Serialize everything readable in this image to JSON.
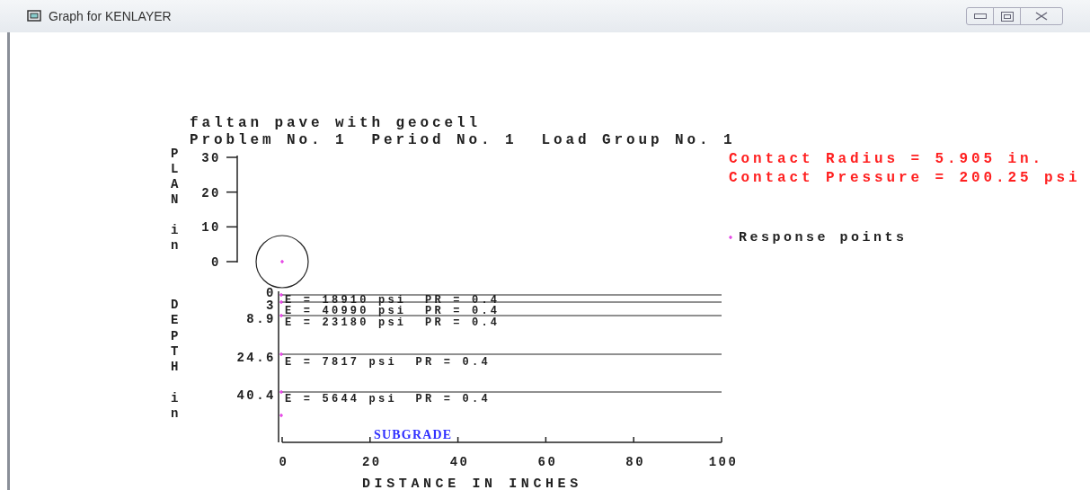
{
  "window": {
    "title": "Graph for KENLAYER"
  },
  "header": {
    "lines": [
      "faltan pave with geocell",
      "Problem No. 1  Period No. 1  Load Group No. 1"
    ]
  },
  "load": {
    "lines": [
      "Contact Radius = 5.905 in.",
      "Contact Pressure = 200.25 psi"
    ],
    "legend": "Response points"
  },
  "plan_view": {
    "ylabel": "PLAN in",
    "yticks": [
      "30",
      "20",
      "10",
      "0"
    ]
  },
  "depth_view": {
    "ylabel": "DEPTH in",
    "layers": [
      {
        "depth": "0",
        "text": "E = 18910 psi  PR = 0.4"
      },
      {
        "depth": "3",
        "text": "E = 40990 psi  PR = 0.4"
      },
      {
        "depth": "8.9",
        "text": "E = 23180 psi  PR = 0.4"
      },
      {
        "depth": "24.6",
        "text": "E = 7817 psi  PR = 0.4"
      },
      {
        "depth": "40.4",
        "text": "E = 5644 psi  PR = 0.4"
      }
    ],
    "subgrade": "SUBGRADE",
    "xticks": [
      "0",
      "20",
      "40",
      "60",
      "80",
      "100"
    ],
    "xlabel": "DISTANCE IN INCHES"
  }
}
